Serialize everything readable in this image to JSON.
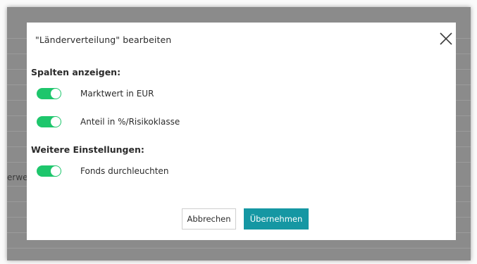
{
  "dialog": {
    "title": "\"Länderverteilung\" bearbeiten",
    "close_icon": "close-icon"
  },
  "sections": {
    "columns_heading": "Spalten anzeigen:",
    "settings_heading": "Weitere Einstellungen:"
  },
  "options": {
    "marktwert": {
      "label": "Marktwert in EUR",
      "enabled": true
    },
    "anteil": {
      "label": "Anteil in %/Risikoklasse",
      "enabled": true
    },
    "fonds": {
      "label": "Fonds durchleuchten",
      "enabled": true
    }
  },
  "buttons": {
    "cancel_label": "Abbrechen",
    "apply_label": "Übernehmen"
  },
  "background": {
    "partial_text": "erwe"
  },
  "colors": {
    "toggle_on": "#1ec66c",
    "primary_button": "#1597a3",
    "overlay": "#8b8b8b"
  }
}
